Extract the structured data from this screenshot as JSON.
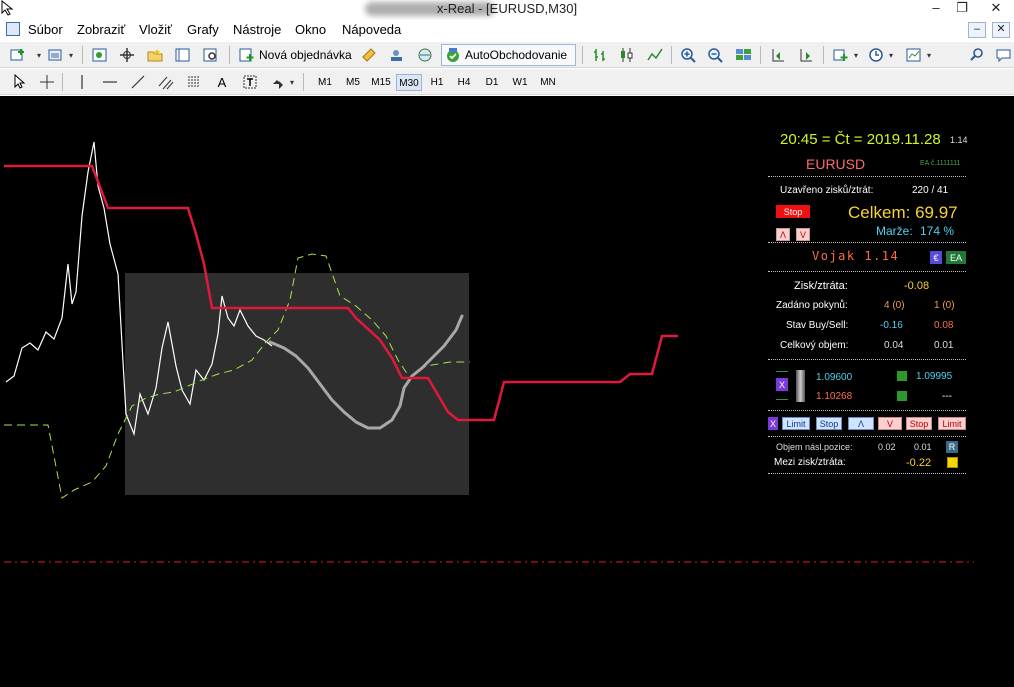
{
  "window": {
    "title_visible": "x-Real - [EURUSD,M30]",
    "min_symbol": "–",
    "restore_symbol": "❐",
    "close_symbol": "✕"
  },
  "menu": [
    "Súbor",
    "Zobraziť",
    "Vložiť",
    "Grafy",
    "Nástroje",
    "Okno",
    "Nápoveda"
  ],
  "toolbar": {
    "new_order_label": "Nová objednávka",
    "auto_trading_label": "AutoObchodovanie"
  },
  "timeframes": [
    "M1",
    "M5",
    "M15",
    "M30",
    "H1",
    "H4",
    "D1",
    "W1",
    "MN"
  ],
  "active_timeframe": "M30",
  "panel": {
    "datetime": "20:45 = Čt = 2019.11.28",
    "version_small": "1.14",
    "symbol": "EURUSD",
    "ea_number": "EA č.1111111",
    "closed_label": "Uzavřeno zisků/ztrát:",
    "closed_value": "220 / 41",
    "stop_label": "Stop",
    "total_label": "Celkem: 69.97",
    "arrow_up": "Λ",
    "arrow_down": "V",
    "margin_label": "Marže:",
    "margin_value": "174 %",
    "vojak_label": "Vojak 1.14",
    "euro_label": "€",
    "ea_label": "EA",
    "pl_label": "Zisk/ztráta:",
    "pl_value": "-0.08",
    "orders_label": "Zadáno pokynů:",
    "orders_buy": "4 (0)",
    "orders_sell": "1 (0)",
    "state_label": "Stav Buy/Sell:",
    "state_buy": "-0.16",
    "state_sell": "0.08",
    "volume_label": "Celkový objem:",
    "volume_buy": "0.04",
    "volume_sell": "0.01",
    "x_label": "X",
    "price_a": "1.09600",
    "price_b": "1.09995",
    "price_c": "1.10268",
    "price_d": "---",
    "btn_x": "X",
    "btn_limit1": "Limit",
    "btn_stop1": "Stop",
    "btn_up": "Λ",
    "btn_down": "V",
    "btn_stop2": "Stop",
    "btn_limit2": "Limit",
    "next_volume_label": "Objem násl.pozice:",
    "next_volume_buy": "0.02",
    "next_volume_sell": "0.01",
    "r_label": "R",
    "between_label": "Mezi zisk/ztráta:",
    "between_value": "-0.22"
  },
  "colors": {
    "chart_bg": "#000000",
    "red_line": "#e0193c",
    "white_line": "#ffffff",
    "green_dash": "#a7e34a",
    "gray_curve": "#a8a8a8",
    "box_fill": "#2e2e2e",
    "datetime": "#d4f51d",
    "symbol": "#ff6b6b",
    "orange": "#f0a040",
    "salmon": "#ff6b4d",
    "cyan": "#4fd0f0"
  }
}
